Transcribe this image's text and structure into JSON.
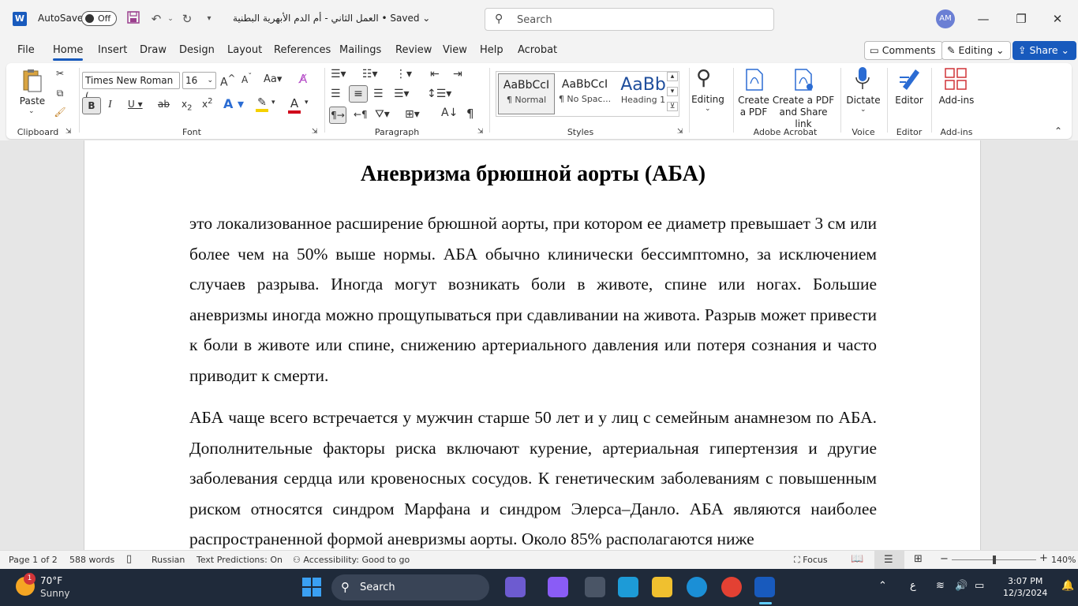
{
  "titlebar": {
    "app_icon": "W",
    "autosave_label": "AutoSave",
    "autosave_state": "Off",
    "document_title": "العمل الثاني - أم الدم الأبهرية البطنية • Saved",
    "search_placeholder": "Search",
    "avatar_initials": "AM"
  },
  "menu": {
    "tabs": [
      "File",
      "Home",
      "Insert",
      "Draw",
      "Design",
      "Layout",
      "References",
      "Mailings",
      "Review",
      "View",
      "Help",
      "Acrobat"
    ],
    "comments": "Comments",
    "editing": "Editing",
    "share": "Share"
  },
  "ribbon": {
    "clipboard": {
      "paste": "Paste",
      "group": "Clipboard"
    },
    "font": {
      "name": "Times New Roman (",
      "size": "16",
      "group": "Font"
    },
    "paragraph": {
      "group": "Paragraph"
    },
    "styles": {
      "group": "Styles",
      "items": [
        {
          "preview": "AaBbCcI",
          "name": "¶ Normal"
        },
        {
          "preview": "AaBbCcI",
          "name": "¶ No Spac..."
        },
        {
          "preview": "AaBb",
          "name": "Heading 1"
        }
      ]
    },
    "editing_btn": "Editing",
    "adobe": {
      "create_pdf": [
        "Create",
        "a PDF"
      ],
      "create_share": [
        "Create a PDF",
        "and Share link"
      ],
      "group": "Adobe Acrobat"
    },
    "voice": {
      "dictate": "Dictate",
      "group": "Voice"
    },
    "editor": {
      "label": "Editor",
      "group": "Editor"
    },
    "addins": {
      "label": "Add-ins",
      "group": "Add-ins"
    }
  },
  "document": {
    "heading": "Аневризма брюшной аорты (АБА)",
    "paragraphs": [
      "это локализованное расширение брюшной аорты, при котором ее диаметр превышает 3 см или более чем на 50% выше нормы. АБА обычно клинически бессимптомно, за исключением случаев разрыва. Иногда могут возникать боли в животе, спине или ногах. Большие аневризмы иногда можно прощупываться при сдавливании на живота. Разрыв может привести к боли в животе или спине, снижению артериального давления или потеря сознания и часто приводит к смерти.",
      "АБА чаще всего встречается у мужчин старше 50 лет и у лиц с семейным анамнезом по АБА. Дополнительные факторы риска включают курение, артериальная гипертензия и другие заболевания сердца или кровеносных сосудов. К генетическим заболеваниям с повышенным риском относятся синдром Марфана и синдром Элерса–Данло. АБА являются наиболее распространенной формой аневризмы аорты. Около 85% располагаются ниже"
    ]
  },
  "statusbar": {
    "page": "Page 1 of 2",
    "words": "588 words",
    "language": "Russian",
    "predictions": "Text Predictions: On",
    "accessibility": "Accessibility: Good to go",
    "focus": "Focus",
    "zoom": "140%"
  },
  "taskbar": {
    "badge": "1",
    "temperature": "70°F",
    "condition": "Sunny",
    "search": "Search",
    "time": "3:07 PM",
    "date": "12/3/2024",
    "lang": "ع"
  }
}
